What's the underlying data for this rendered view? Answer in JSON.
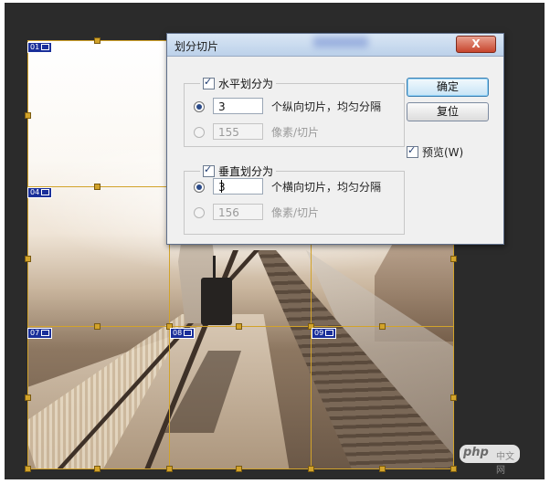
{
  "slices": [
    {
      "id": "01"
    },
    {
      "id": "04"
    },
    {
      "id": "07"
    },
    {
      "id": "08"
    },
    {
      "id": "09"
    }
  ],
  "dialog": {
    "title": "划分切片",
    "close_glyph": "X",
    "horizontal": {
      "label": "水平划分为",
      "checked": true,
      "count_value": "3",
      "count_suffix": "个纵向切片，均匀分隔",
      "pixel_value": "155",
      "pixel_suffix": "像素/切片"
    },
    "vertical": {
      "label": "垂直划分为",
      "checked": true,
      "count_value": "3",
      "count_suffix": "个横向切片，均匀分隔",
      "pixel_value": "156",
      "pixel_suffix": "像素/切片"
    },
    "ok_label": "确定",
    "reset_label": "复位",
    "preview_label": "预览(W)",
    "preview_checked": true
  },
  "watermark": {
    "logo": "php",
    "site": "中文网"
  },
  "colors": {
    "workspace": "#2b2b2b",
    "slice_line": "#d2a32a",
    "slice_label": "#1a2f9a"
  }
}
